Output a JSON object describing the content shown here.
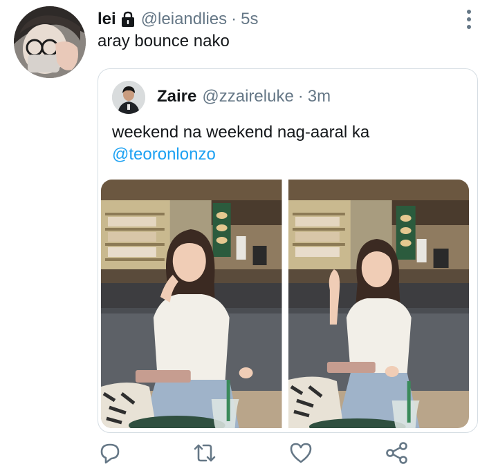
{
  "tweet": {
    "author_name": "lei",
    "author_handle": "@leiandlies",
    "separator": "·",
    "time": "5s",
    "text": "aray bounce nako",
    "locked": true
  },
  "quoted_tweet": {
    "author_name": "Zaire",
    "author_handle": "@zzaireluke",
    "separator": "·",
    "time": "3m",
    "text": "weekend na weekend nag-aaral ka",
    "mention": "@teoronlonzo",
    "media_count": 2
  },
  "actions": {
    "icons": [
      "reply-icon",
      "retweet-icon",
      "like-icon",
      "share-icon"
    ]
  },
  "colors": {
    "text": "#14171a",
    "secondary": "#657786",
    "link": "#1da1f2",
    "border": "#d5dde3"
  }
}
